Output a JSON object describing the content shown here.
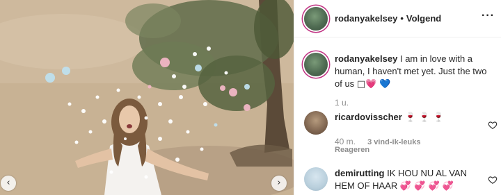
{
  "post": {
    "username": "rodanyakelsey",
    "separator": "•",
    "follow_label": "Volgend",
    "more_label": "···",
    "nav_prev": "‹",
    "nav_next": "›"
  },
  "caption": {
    "username": "rodanyakelsey",
    "text": "I am in love with a human, I haven't met yet. Just the two of us",
    "emoji": "□💗 💙",
    "time": "1 u."
  },
  "comments": [
    {
      "username": "ricardovisscher",
      "text": "🍷 🍷 🍷",
      "time": "40 m.",
      "likes": "3 vind-ik-leuks",
      "reply_label": "Reageren"
    },
    {
      "username": "demirutting",
      "text": "IK HOU NU AL VAN HEM OF HAAR",
      "emoji": "💞 💞 💞 💞"
    }
  ],
  "icons": {
    "heart": "heart-outline-icon",
    "more": "more-icon",
    "prev": "chevron-left-icon",
    "next": "chevron-right-icon"
  },
  "colors": {
    "story_ring": "#c13584",
    "text": "#262626",
    "muted": "#8e8e8e",
    "divider": "#efefef"
  }
}
